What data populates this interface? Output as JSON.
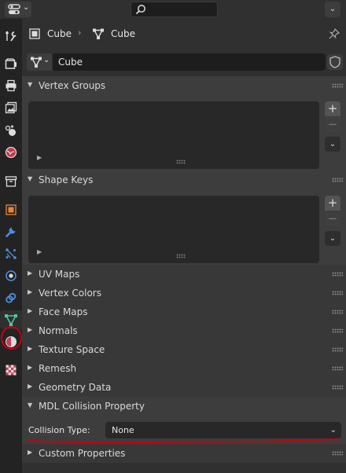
{
  "topbar": {
    "editor_type_icon": "properties-editor-icon",
    "search_icon": "search-icon",
    "dropdown_icon": "chevron-down-icon"
  },
  "sidebar": {
    "tabs": [
      {
        "name": "tool-icon",
        "active": false
      },
      {
        "name": "render-icon",
        "active": false
      },
      {
        "name": "output-icon",
        "active": false
      },
      {
        "name": "view-layer-icon",
        "active": false
      },
      {
        "name": "scene-icon",
        "active": false
      },
      {
        "name": "world-icon",
        "active": false
      },
      {
        "name": "collection-icon",
        "active": false
      },
      {
        "name": "object-icon",
        "active": false
      },
      {
        "name": "modifier-icon",
        "active": false
      },
      {
        "name": "particles-icon",
        "active": false
      },
      {
        "name": "physics-icon",
        "active": false
      },
      {
        "name": "constraints-icon",
        "active": false
      },
      {
        "name": "mesh-data-icon",
        "active": true
      },
      {
        "name": "material-icon",
        "active": false
      },
      {
        "name": "texture-icon",
        "active": false
      }
    ]
  },
  "breadcrumb": {
    "object_name": "Cube",
    "mesh_name": "Cube"
  },
  "datablock": {
    "name": "Cube"
  },
  "panels": {
    "vertex_groups": "Vertex Groups",
    "shape_keys": "Shape Keys",
    "uv_maps": "UV Maps",
    "vertex_colors": "Vertex Colors",
    "face_maps": "Face Maps",
    "normals": "Normals",
    "texture_space": "Texture Space",
    "remesh": "Remesh",
    "geometry_data": "Geometry Data",
    "mdl_collision": "MDL Collision Property",
    "custom_properties": "Custom Properties"
  },
  "collision": {
    "label": "Collision Type:",
    "value": "None"
  },
  "buttons": {
    "add": "+",
    "remove": "−",
    "specials": "⌄"
  },
  "colors": {
    "annotation_red": "#c60010",
    "panel_bg": "#3d3d3d",
    "field_bg": "#1d1d1d"
  }
}
